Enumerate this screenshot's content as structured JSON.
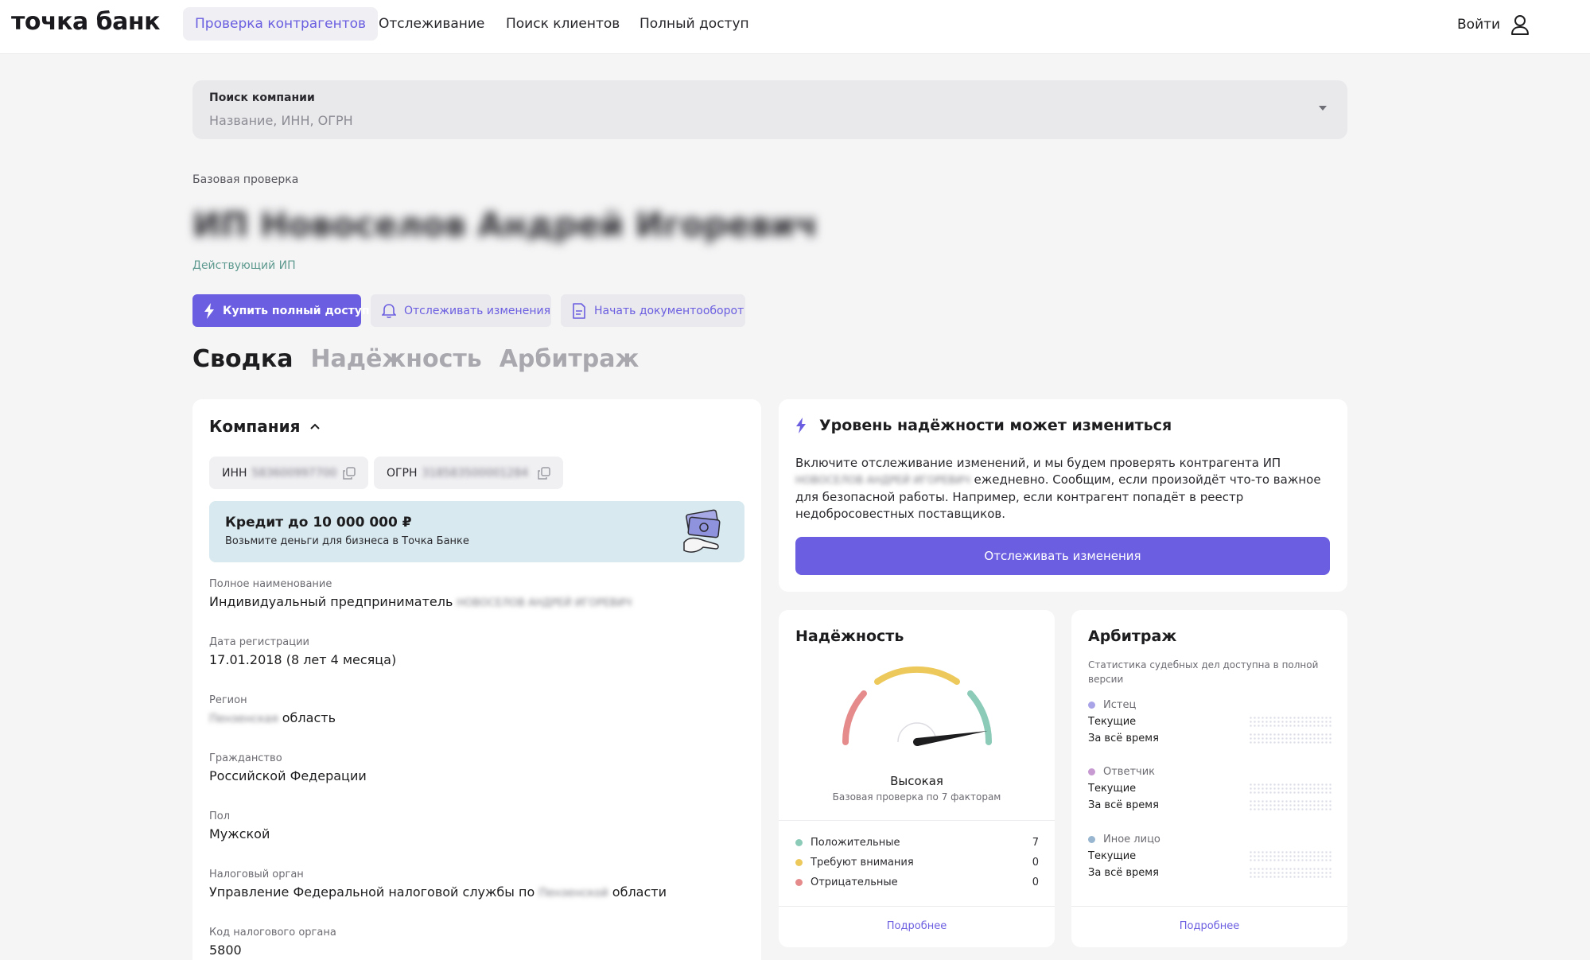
{
  "header": {
    "logo": "точка банк",
    "nav": [
      {
        "label": "Проверка контрагентов",
        "active": true
      },
      {
        "label": "Отслеживание",
        "active": false
      },
      {
        "label": "Поиск клиентов",
        "active": false
      },
      {
        "label": "Полный доступ",
        "active": false
      }
    ],
    "login_label": "Войти",
    "login_icon": "user-icon"
  },
  "search": {
    "label": "Поиск компании",
    "placeholder": "Название, ИНН, ОГРН"
  },
  "company": {
    "breadcrumb": "Базовая проверка",
    "name": "ИП Новоселов Андрей Игоревич",
    "status": "Действующий ИП"
  },
  "actions": {
    "buy": "Купить полный доступ",
    "track": "Отслеживать изменения",
    "docs": "Начать документооборот"
  },
  "tabs": [
    "Сводка",
    "Надёжность",
    "Арбитраж"
  ],
  "company_card": {
    "title": "Компания",
    "inn_label": "ИНН",
    "inn_value": "583600997700",
    "ogrn_label": "ОГРН",
    "ogrn_value": "318583500001284",
    "promo_title": "Кредит до 10 000 000 ₽",
    "promo_sub": "Возьмите деньги для бизнеса в Точка Банке",
    "fields": {
      "full_name_label": "Полное наименование",
      "full_name_prefix": "Индивидуальный предприниматель",
      "full_name_hidden": "НОВОСЕЛОВ АНДРЕЙ ИГОРЕВИЧ",
      "reg_label": "Дата регистрации",
      "reg_value": "17.01.2018 (8 лет 4 месяца)",
      "region_label": "Регион",
      "region_hidden": "Пензенская",
      "region_suffix": "область",
      "citizenship_label": "Гражданство",
      "citizenship_value": "Российской Федерации",
      "gender_label": "Пол",
      "gender_value": "Мужской",
      "tax_label": "Налоговый орган",
      "tax_prefix": "Управление Федеральной налоговой службы по",
      "tax_hidden": "Пензенской",
      "tax_suffix": "области",
      "tax_code_label": "Код налогового органа",
      "tax_code_value": "5800"
    }
  },
  "alert": {
    "title": "Уровень надёжности может измениться",
    "text_1": "Включите отслеживание изменений, и мы будем проверять контрагента ИП",
    "text_hidden": "НОВОСЕЛОВ АНДРЕЙ ИГОРЕВИЧ",
    "text_2": "ежедневно. Сообщим, если произойдёт что-то важное для безопасной работы. Например, если контрагент попадёт в реестр недобросовестных поставщиков.",
    "button": "Отслеживать изменения"
  },
  "reliability": {
    "title": "Надёжность",
    "level": "Высокая",
    "gauge_level": 0.95,
    "subtitle": "Базовая проверка по 7 факторам",
    "legend": [
      {
        "label": "Положительные",
        "count": "7",
        "color": "#8ccbb8"
      },
      {
        "label": "Требуют внимания",
        "count": "0",
        "color": "#ecc95a"
      },
      {
        "label": "Отрицательные",
        "count": "0",
        "color": "#e58b8b"
      }
    ],
    "more": "Подробнее"
  },
  "arbitration": {
    "title": "Арбитраж",
    "subtitle": "Статистика судебных дел доступна в полной версии",
    "groups": [
      {
        "role": "Истец",
        "color": "#a9a4e8",
        "current": "Текущие",
        "all": "За всё время"
      },
      {
        "role": "Ответчик",
        "color": "#c79ad2",
        "current": "Текущие",
        "all": "За всё время"
      },
      {
        "role": "Иное лицо",
        "color": "#98b6cf",
        "current": "Текущие",
        "all": "За всё время"
      }
    ],
    "more": "Подробнее"
  },
  "colors": {
    "accent": "#6b5ee0",
    "status_green": "#5e9a8f",
    "promo_bg": "#d8e9ef"
  }
}
